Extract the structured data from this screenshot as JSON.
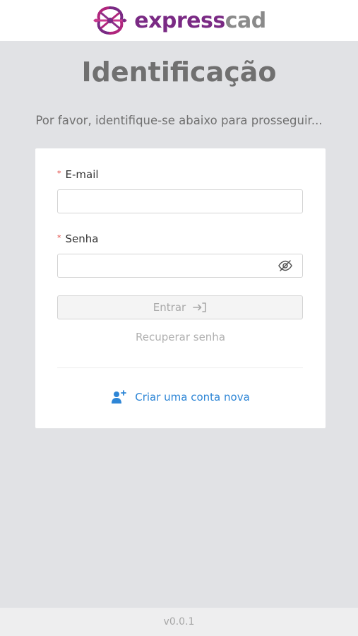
{
  "header": {
    "logo_text_primary": "express",
    "logo_text_secondary": "cad",
    "logo_icon": "expresscad-logo-icon",
    "brand_color": "#7a2a84"
  },
  "page": {
    "title": "Identificação",
    "subtitle": "Por favor, identifique-se abaixo para prosseguir..."
  },
  "form": {
    "required_marker": "*",
    "email": {
      "label": "E-mail",
      "value": "",
      "placeholder": ""
    },
    "password": {
      "label": "Senha",
      "value": "",
      "placeholder": "",
      "toggle_icon": "eye-off-icon"
    },
    "submit": {
      "label": "Entrar",
      "icon": "login-arrow-icon",
      "enabled": false
    },
    "recover_link": "Recuperar senha",
    "create_account": {
      "label": "Criar uma conta nova",
      "icon": "user-add-icon",
      "color": "#2e86d6"
    }
  },
  "footer": {
    "version": "v0.0.1"
  }
}
